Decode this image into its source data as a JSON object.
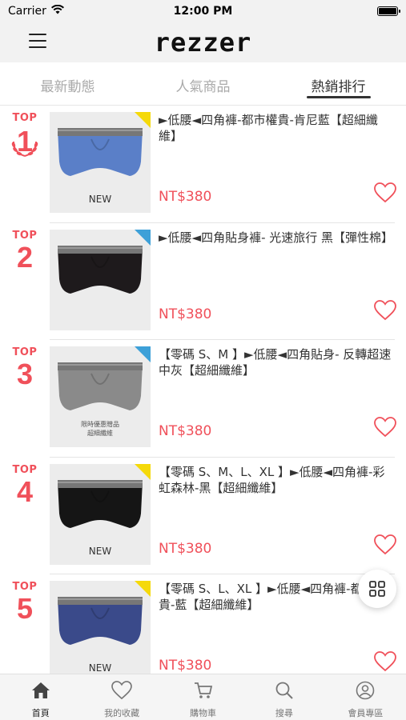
{
  "status_bar": {
    "carrier": "Carrier",
    "time": "12:00 PM"
  },
  "header": {
    "logo": "rezzer",
    "menu_icon": "hamburger-menu-icon"
  },
  "tabs": [
    {
      "label": "最新動態",
      "active": false
    },
    {
      "label": "人氣商品",
      "active": false
    },
    {
      "label": "熱銷排行",
      "active": true
    }
  ],
  "products": [
    {
      "rank_label": "TOP",
      "rank": "1",
      "title": "►低腰◄四角褲-都市權貴-肯尼藍【超細纖維】",
      "price": "NT$380",
      "badge": "NEW",
      "corner_color": "#f5d90a",
      "product_color": "#5a7fc8"
    },
    {
      "rank_label": "TOP",
      "rank": "2",
      "title": "►低腰◄四角貼身褲- 光速旅行 黑【彈性棉】",
      "price": "NT$380",
      "badge": "",
      "corner_color": "#3da0d8",
      "product_color": "#1e1a1c"
    },
    {
      "rank_label": "TOP",
      "rank": "3",
      "title": "【零碼 S、M 】►低腰◄四角貼身- 反轉超速中灰【超細纖維】",
      "price": "NT$380",
      "badge": "限時優惠贈品 超細纖維",
      "corner_color": "#3da0d8",
      "product_color": "#8a8a8a"
    },
    {
      "rank_label": "TOP",
      "rank": "4",
      "title": "【零碼 S、M、L、XL 】►低腰◄四角褲-彩虹森林-黑【超細纖維】",
      "price": "NT$380",
      "badge": "NEW",
      "corner_color": "#f5d90a",
      "product_color": "#151515"
    },
    {
      "rank_label": "TOP",
      "rank": "5",
      "title": "【零碼 S、L、XL 】►低腰◄四角褲-都市權貴-藍【超細纖維】",
      "price": "NT$380",
      "badge": "NEW",
      "corner_color": "#f5d90a",
      "product_color": "#3a4a8a"
    }
  ],
  "bottom_nav": [
    {
      "label": "首頁",
      "icon": "home-icon",
      "active": true
    },
    {
      "label": "我的收藏",
      "icon": "heart-icon",
      "active": false
    },
    {
      "label": "購物車",
      "icon": "cart-icon",
      "active": false
    },
    {
      "label": "搜尋",
      "icon": "search-icon",
      "active": false
    },
    {
      "label": "會員專區",
      "icon": "user-icon",
      "active": false
    }
  ],
  "colors": {
    "accent": "#f0505a",
    "header_bg": "#f2f2f2"
  }
}
